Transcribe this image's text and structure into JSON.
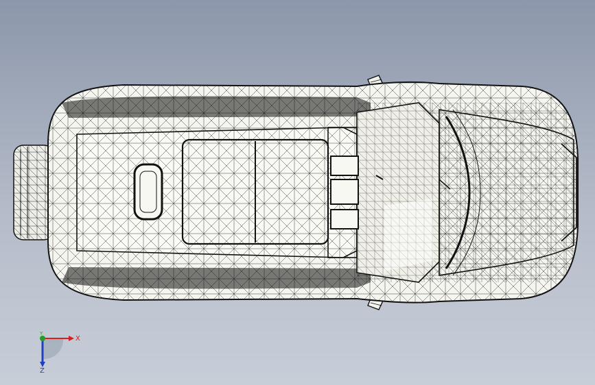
{
  "viewport": {
    "background_top": "#8c97ab",
    "background_bottom": "#c8ced8",
    "display_mode": "wireframe",
    "view": "top"
  },
  "model": {
    "type": "car-body-mesh",
    "fill": "#f4f4ee",
    "edge_color": "#1a1a1a"
  },
  "triad": {
    "x_label": "X",
    "y_label": "Y",
    "z_label": "Z",
    "x_color": "#d42020",
    "y_color": "#20a020",
    "z_color": "#2040c0"
  }
}
